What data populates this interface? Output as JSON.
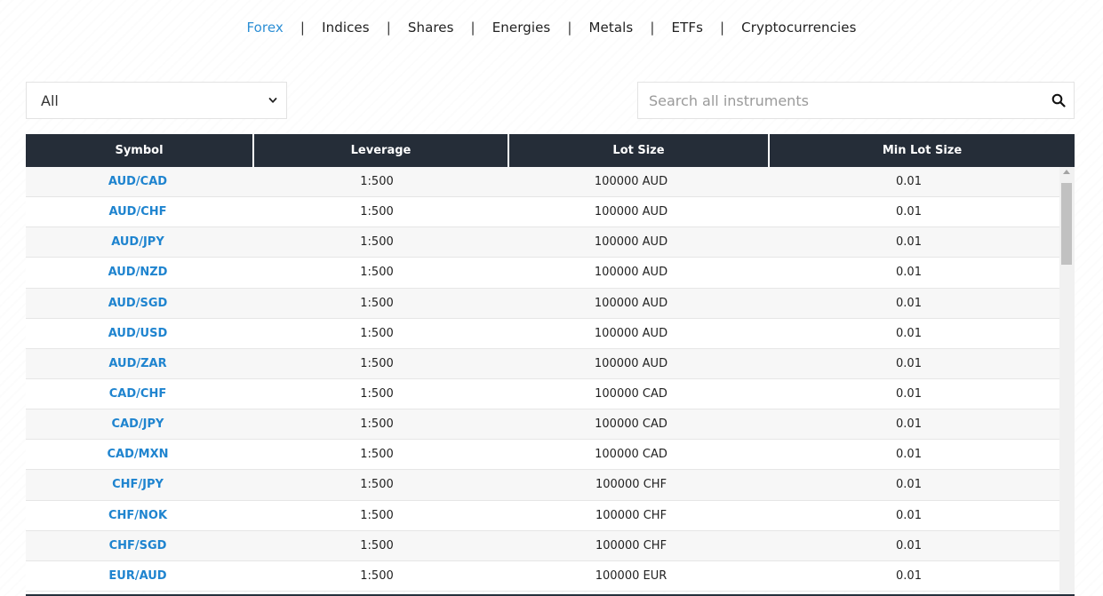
{
  "nav": {
    "items": [
      {
        "label": "Forex",
        "active": true
      },
      {
        "label": "Indices",
        "active": false
      },
      {
        "label": "Shares",
        "active": false
      },
      {
        "label": "Energies",
        "active": false
      },
      {
        "label": "Metals",
        "active": false
      },
      {
        "label": "ETFs",
        "active": false
      },
      {
        "label": "Cryptocurrencies",
        "active": false
      }
    ],
    "separator": "|"
  },
  "filter": {
    "selected": "All",
    "icon": "chevron-down-icon"
  },
  "search": {
    "placeholder": "Search all instruments",
    "value": "",
    "icon": "search-icon"
  },
  "table": {
    "headers": [
      "Symbol",
      "Leverage",
      "Lot Size",
      "Min Lot Size"
    ],
    "rows": [
      {
        "symbol": "AUD/CAD",
        "leverage": "1:500",
        "lot_size": "100000 AUD",
        "min_lot": "0.01"
      },
      {
        "symbol": "AUD/CHF",
        "leverage": "1:500",
        "lot_size": "100000 AUD",
        "min_lot": "0.01"
      },
      {
        "symbol": "AUD/JPY",
        "leverage": "1:500",
        "lot_size": "100000 AUD",
        "min_lot": "0.01"
      },
      {
        "symbol": "AUD/NZD",
        "leverage": "1:500",
        "lot_size": "100000 AUD",
        "min_lot": "0.01"
      },
      {
        "symbol": "AUD/SGD",
        "leverage": "1:500",
        "lot_size": "100000 AUD",
        "min_lot": "0.01"
      },
      {
        "symbol": "AUD/USD",
        "leverage": "1:500",
        "lot_size": "100000 AUD",
        "min_lot": "0.01"
      },
      {
        "symbol": "AUD/ZAR",
        "leverage": "1:500",
        "lot_size": "100000 AUD",
        "min_lot": "0.01"
      },
      {
        "symbol": "CAD/CHF",
        "leverage": "1:500",
        "lot_size": "100000 CAD",
        "min_lot": "0.01"
      },
      {
        "symbol": "CAD/JPY",
        "leverage": "1:500",
        "lot_size": "100000 CAD",
        "min_lot": "0.01"
      },
      {
        "symbol": "CAD/MXN",
        "leverage": "1:500",
        "lot_size": "100000 CAD",
        "min_lot": "0.01"
      },
      {
        "symbol": "CHF/JPY",
        "leverage": "1:500",
        "lot_size": "100000 CHF",
        "min_lot": "0.01"
      },
      {
        "symbol": "CHF/NOK",
        "leverage": "1:500",
        "lot_size": "100000 CHF",
        "min_lot": "0.01"
      },
      {
        "symbol": "CHF/SGD",
        "leverage": "1:500",
        "lot_size": "100000 CHF",
        "min_lot": "0.01"
      },
      {
        "symbol": "EUR/AUD",
        "leverage": "1:500",
        "lot_size": "100000 EUR",
        "min_lot": "0.01"
      }
    ]
  },
  "colors": {
    "accent": "#2d8fd5",
    "header_bg": "#252d38",
    "link": "#1f84cf"
  }
}
